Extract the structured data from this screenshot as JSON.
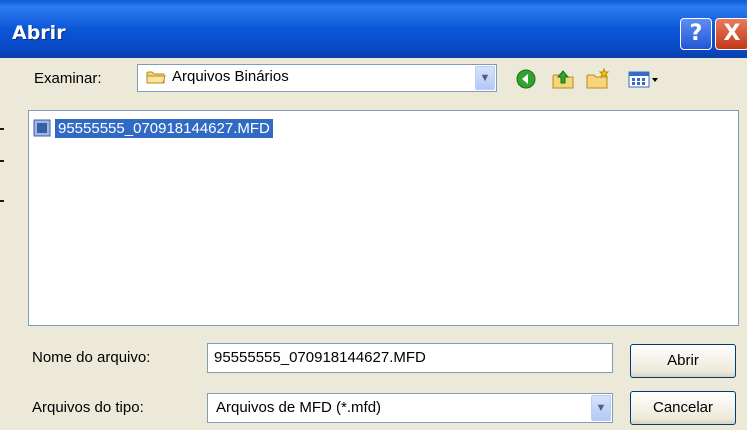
{
  "window": {
    "title": "Abrir",
    "help_label": "?",
    "close_label": "X"
  },
  "lookin": {
    "label": "Examinar:",
    "value": "Arquivos Binários"
  },
  "toolbar": {
    "icons": [
      "back-icon",
      "up-folder-icon",
      "new-folder-icon",
      "views-menu-icon"
    ]
  },
  "files": [
    {
      "name": "95555555_070918144627.MFD",
      "selected": true
    }
  ],
  "filename": {
    "label": "Nome do arquivo:",
    "value": "95555555_070918144627.MFD"
  },
  "filetype": {
    "label": "Arquivos do tipo:",
    "value": "Arquivos de MFD (*.mfd)"
  },
  "buttons": {
    "open": "Abrir",
    "cancel": "Cancelar"
  },
  "colors": {
    "titlebar": "#0a5bd6",
    "selection": "#316ac5",
    "face": "#ece9d8"
  }
}
